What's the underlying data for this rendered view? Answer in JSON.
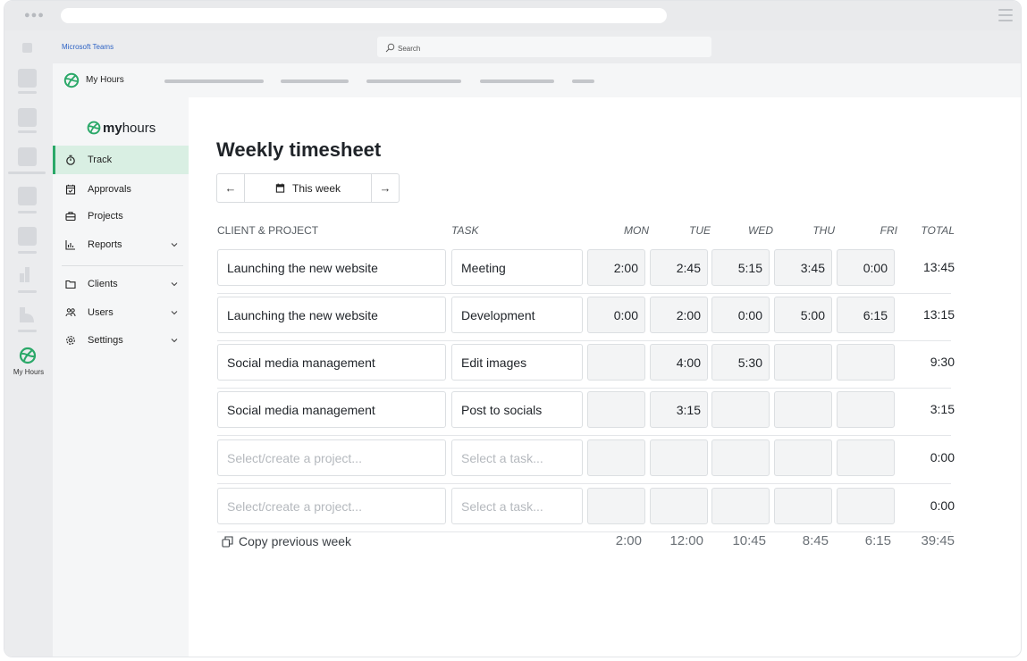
{
  "teams": {
    "brand": "Microsoft Teams",
    "search_placeholder": "Search",
    "app_name": "My Hours",
    "rail_app_label": "My Hours"
  },
  "sidebar": {
    "logo_bold": "my",
    "logo_light": "hours",
    "items": [
      {
        "label": "Track",
        "icon": "stopwatch-icon",
        "active": true
      },
      {
        "label": "Approvals",
        "icon": "calendar-check-icon"
      },
      {
        "label": "Projects",
        "icon": "briefcase-icon"
      },
      {
        "label": "Reports",
        "icon": "bar-chart-icon",
        "expandable": true
      },
      {
        "label": "Clients",
        "icon": "folder-icon",
        "expandable": true
      },
      {
        "label": "Users",
        "icon": "users-icon",
        "expandable": true
      },
      {
        "label": "Settings",
        "icon": "gear-icon",
        "expandable": true
      }
    ]
  },
  "main": {
    "title": "Weekly timesheet",
    "week_label": "This week",
    "prev_arrow": "←",
    "next_arrow": "→",
    "columns": {
      "project": "CLIENT & PROJECT",
      "task": "TASK",
      "mon": "MON",
      "tue": "TUE",
      "wed": "WED",
      "thu": "THU",
      "fri": "FRI",
      "total": "TOTAL"
    },
    "rows": [
      {
        "project": "Launching the new website",
        "task": "Meeting",
        "days": [
          "2:00",
          "2:45",
          "5:15",
          "3:45",
          "0:00"
        ],
        "total": "13:45"
      },
      {
        "project": "Launching the new website",
        "task": "Development",
        "days": [
          "0:00",
          "2:00",
          "0:00",
          "5:00",
          "6:15"
        ],
        "total": "13:15"
      },
      {
        "project": "Social media management",
        "task": "Edit images",
        "days": [
          "",
          "4:00",
          "5:30",
          "",
          ""
        ],
        "total": "9:30"
      },
      {
        "project": "Social media management",
        "task": "Post to socials",
        "days": [
          "",
          "3:15",
          "",
          "",
          ""
        ],
        "total": "3:15"
      },
      {
        "project": "",
        "task": "",
        "days": [
          "",
          "",
          "",
          "",
          ""
        ],
        "total": "0:00"
      },
      {
        "project": "",
        "task": "",
        "days": [
          "",
          "",
          "",
          "",
          ""
        ],
        "total": "0:00"
      }
    ],
    "project_placeholder": "Select/create a project...",
    "task_placeholder": "Select a task...",
    "copy_label": "Copy previous week",
    "day_totals": [
      "2:00",
      "12:00",
      "10:45",
      "8:45",
      "6:15"
    ],
    "grand_total": "39:45"
  },
  "colors": {
    "accent": "#2aa868",
    "active_bg": "#d9efe3",
    "cell_bg": "#f3f4f5"
  }
}
